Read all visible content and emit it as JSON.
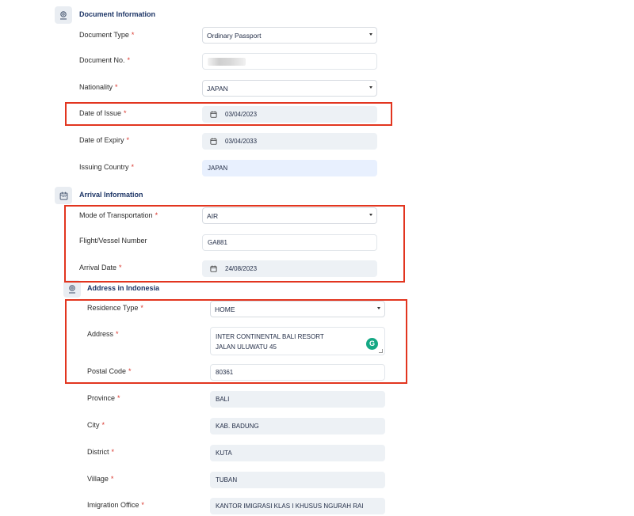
{
  "document_section": {
    "title": "Document Information",
    "icon": "passport-icon",
    "document_type": {
      "label": "Document Type",
      "value": "Ordinary Passport"
    },
    "document_no": {
      "label": "Document No."
    },
    "nationality": {
      "label": "Nationality",
      "value": "JAPAN"
    },
    "date_of_issue": {
      "label": "Date of Issue",
      "value": "03/04/2023"
    },
    "date_of_expiry": {
      "label": "Date of Expiry",
      "value": "03/04/2033"
    },
    "issuing_country": {
      "label": "Issuing Country",
      "value": "JAPAN"
    }
  },
  "arrival_section": {
    "title": "Arrival Information",
    "icon": "calendar-icon",
    "mode_of_transportation": {
      "label": "Mode of Transportation",
      "value": "AIR"
    },
    "flight_number": {
      "label": "Flight/Vessel Number",
      "value": "GA881"
    },
    "arrival_date": {
      "label": "Arrival Date",
      "value": "24/08/2023"
    }
  },
  "address_section": {
    "title": "Address in Indonesia",
    "icon": "location-icon",
    "residence_type": {
      "label": "Residence Type",
      "value": "HOME"
    },
    "address": {
      "label": "Address",
      "line1": "INTER CONTINENTAL BALI RESORT",
      "line2": "JALAN ULUWATU 45"
    },
    "postal_code": {
      "label": "Postal Code",
      "value": "80361"
    },
    "province": {
      "label": "Province",
      "value": "BALI"
    },
    "city": {
      "label": "City",
      "value": "KAB. BADUNG"
    },
    "district": {
      "label": "District",
      "value": "KUTA"
    },
    "village": {
      "label": "Village",
      "value": "TUBAN"
    },
    "immigration_office": {
      "label": "Imigration Office",
      "value": "KANTOR IMIGRASI KLAS I KHUSUS NGURAH RAI"
    }
  },
  "required_marker": "*",
  "colors": {
    "required": "#d9342b",
    "highlight_box": "#e2351f",
    "section_title": "#1d3566",
    "grammarly": "#15a884"
  },
  "grammarly_letter": "G"
}
